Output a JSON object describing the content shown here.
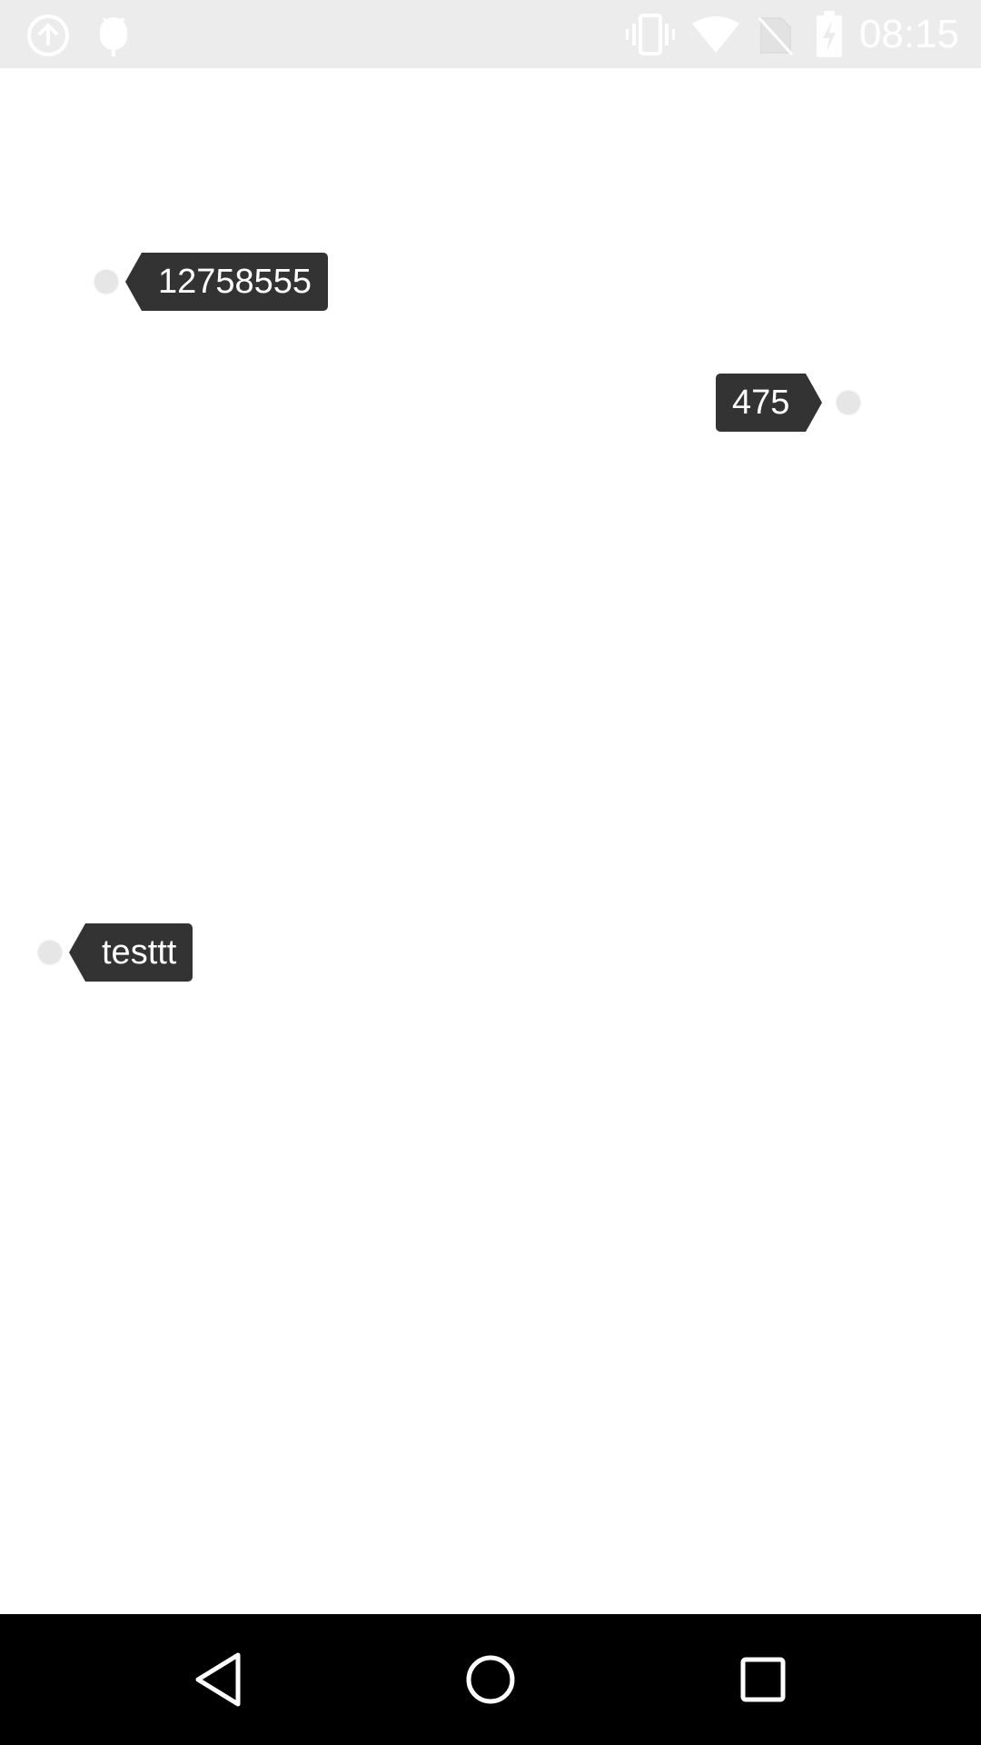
{
  "status_bar": {
    "time": "08:15",
    "icons": [
      "upload-icon",
      "android-debug-icon",
      "vibrate-icon",
      "wifi-icon",
      "no-sim-icon",
      "battery-charging-icon"
    ]
  },
  "tags": [
    {
      "text": "12758555",
      "direction": "dot-left"
    },
    {
      "text": "475",
      "direction": "dot-right"
    },
    {
      "text": "testtt",
      "direction": "dot-left"
    }
  ],
  "nav_bar": {
    "icons": [
      "back-icon",
      "home-icon",
      "recents-icon"
    ]
  },
  "colors": {
    "status_bar_bg": "#ececec",
    "tag_bg": "#333333",
    "tag_text": "#ffffff",
    "dot": "#e6e6e6",
    "nav_bar_bg": "#000000"
  }
}
